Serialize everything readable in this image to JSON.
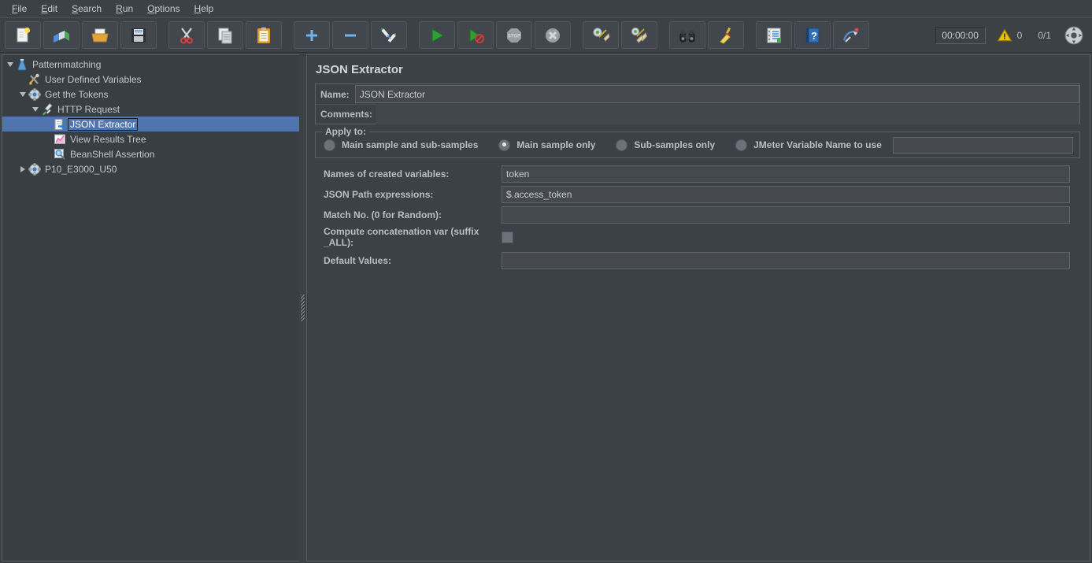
{
  "menubar": {
    "items": [
      {
        "label": "File",
        "accel": "F"
      },
      {
        "label": "Edit",
        "accel": "E"
      },
      {
        "label": "Search",
        "accel": "S"
      },
      {
        "label": "Run",
        "accel": "R"
      },
      {
        "label": "Options",
        "accel": "O"
      },
      {
        "label": "Help",
        "accel": "H"
      }
    ]
  },
  "toolbar": {
    "buttons": [
      {
        "name": "new-test-plan",
        "icon": "new-page-icon",
        "tooltip": "New"
      },
      {
        "name": "open-templates",
        "icon": "templates-icon",
        "tooltip": "Templates"
      },
      {
        "name": "open-file",
        "icon": "open-folder-icon",
        "tooltip": "Open"
      },
      {
        "name": "save-test-plan",
        "icon": "save-floppy-icon",
        "tooltip": "Save"
      },
      {
        "name": "cut",
        "icon": "scissors-icon",
        "tooltip": "Cut"
      },
      {
        "name": "copy",
        "icon": "copy-pages-icon",
        "tooltip": "Copy"
      },
      {
        "name": "paste",
        "icon": "clipboard-icon",
        "tooltip": "Paste"
      },
      {
        "name": "expand-all",
        "icon": "plus-icon",
        "tooltip": "Expand all"
      },
      {
        "name": "collapse-all",
        "icon": "minus-icon",
        "tooltip": "Collapse all"
      },
      {
        "name": "toggle-element",
        "icon": "toggle-pencils-icon",
        "tooltip": "Toggle"
      },
      {
        "name": "start",
        "icon": "play-green-icon",
        "tooltip": "Start"
      },
      {
        "name": "start-no-pauses",
        "icon": "play-no-timers-icon",
        "tooltip": "Start no pauses"
      },
      {
        "name": "stop",
        "icon": "stop-sign-icon",
        "tooltip": "Stop"
      },
      {
        "name": "shutdown",
        "icon": "shutdown-x-icon",
        "tooltip": "Shutdown"
      },
      {
        "name": "clear",
        "icon": "clear-broom-icon",
        "tooltip": "Clear"
      },
      {
        "name": "clear-all",
        "icon": "clear-all-broom-icon",
        "tooltip": "Clear All"
      },
      {
        "name": "search",
        "icon": "binoculars-icon",
        "tooltip": "Search"
      },
      {
        "name": "reset-search",
        "icon": "reset-broom-icon",
        "tooltip": "Reset Search"
      },
      {
        "name": "function-helper",
        "icon": "function-book-icon",
        "tooltip": "Function Helper Dialog"
      },
      {
        "name": "help",
        "icon": "help-book-icon",
        "tooltip": "Help"
      },
      {
        "name": "undo",
        "icon": "undo-icon",
        "tooltip": "Undo"
      }
    ],
    "status": {
      "timer": "00:00:00",
      "warning_count": "0",
      "thread_count": "0/1"
    }
  },
  "tree": {
    "nodes": [
      {
        "label": "Patternmatching",
        "icon": "test-plan-icon",
        "depth": 0,
        "twist": "down",
        "selected": false
      },
      {
        "label": "User Defined Variables",
        "icon": "user-defined-variables-icon",
        "depth": 1,
        "twist": "none",
        "selected": false
      },
      {
        "label": "Get the Tokens",
        "icon": "thread-group-icon",
        "depth": 1,
        "twist": "down",
        "selected": false
      },
      {
        "label": "HTTP Request",
        "icon": "http-request-icon",
        "depth": 2,
        "twist": "down",
        "selected": false
      },
      {
        "label": "JSON Extractor",
        "icon": "json-extractor-icon",
        "depth": 3,
        "twist": "none",
        "selected": true
      },
      {
        "label": "View Results Tree",
        "icon": "view-results-tree-icon",
        "depth": 3,
        "twist": "none",
        "selected": false
      },
      {
        "label": "BeanShell Assertion",
        "icon": "beanshell-assertion-icon",
        "depth": 3,
        "twist": "none",
        "selected": false
      },
      {
        "label": "P10_E3000_U50",
        "icon": "thread-group-icon",
        "depth": 1,
        "twist": "right",
        "selected": false
      }
    ]
  },
  "detail": {
    "title": "JSON Extractor",
    "name_label": "Name:",
    "name_value": "JSON Extractor",
    "comments_label": "Comments:",
    "comments_value": "",
    "apply_to": {
      "legend": "Apply to:",
      "options": [
        {
          "label": "Main sample and sub-samples",
          "selected": false
        },
        {
          "label": "Main sample only",
          "selected": true
        },
        {
          "label": "Sub-samples only",
          "selected": false
        },
        {
          "label": "JMeter Variable Name to use",
          "selected": false
        }
      ],
      "variable_name_value": ""
    },
    "fields": [
      {
        "label": "Names of created variables:",
        "value": "token",
        "type": "text"
      },
      {
        "label": "JSON Path expressions:",
        "value": "$.access_token",
        "type": "text"
      },
      {
        "label": "Match No. (0 for Random):",
        "value": "",
        "type": "text"
      }
    ],
    "concat_label": "Compute concatenation var (suffix _ALL):",
    "concat_checked": false,
    "default_values_label": "Default Values:",
    "default_values_value": ""
  },
  "colors": {
    "background": "#3c4145",
    "selection": "#4f74ae",
    "field_bg": "#45494d",
    "text": "#b9bec3"
  }
}
